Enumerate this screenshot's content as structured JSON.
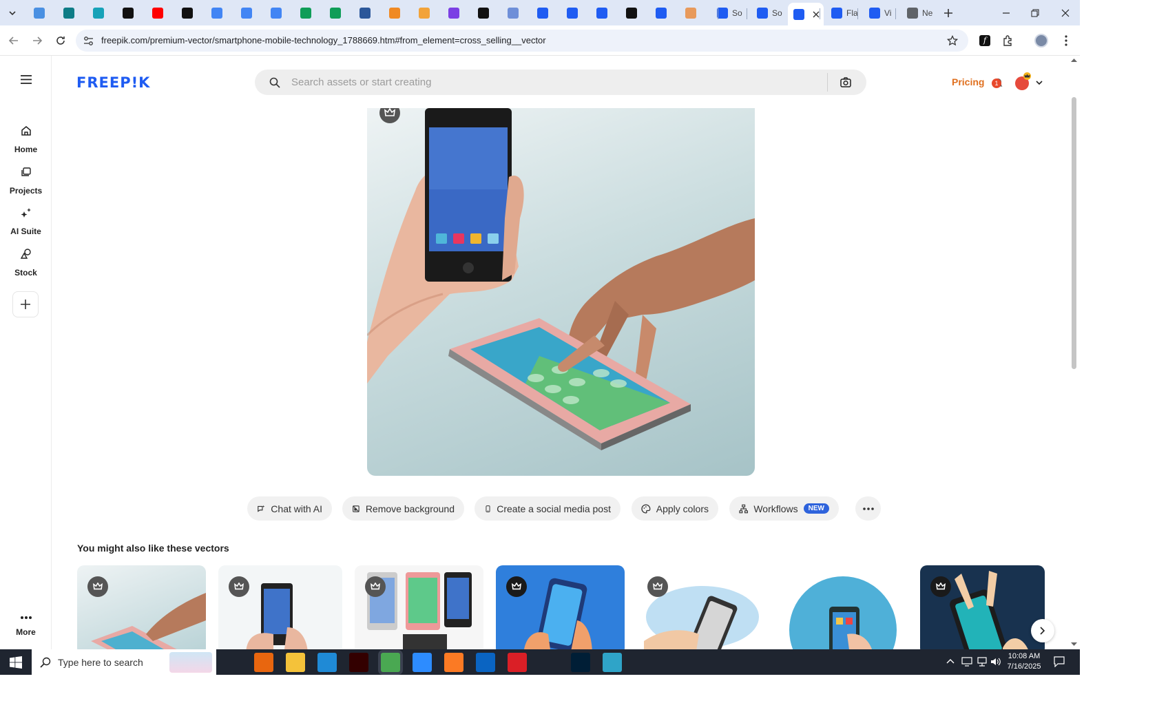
{
  "browser": {
    "tabs": [
      {
        "title": "",
        "icon": "circle-blue-icon"
      },
      {
        "title": "",
        "icon": "shield-teal-icon"
      },
      {
        "title": "",
        "icon": "hexagon-teal-icon"
      },
      {
        "title": "",
        "icon": "openai-icon"
      },
      {
        "title": "",
        "icon": "youtube-icon"
      },
      {
        "title": "",
        "icon": "bolt-icon"
      },
      {
        "title": "",
        "icon": "docs-icon"
      },
      {
        "title": "",
        "icon": "docs-icon"
      },
      {
        "title": "",
        "icon": "docs-icon"
      },
      {
        "title": "",
        "icon": "sheets-icon"
      },
      {
        "title": "",
        "icon": "sheets-icon"
      },
      {
        "title": "",
        "icon": "word-icon"
      },
      {
        "title": "",
        "icon": "orange-box-icon"
      },
      {
        "title": "",
        "icon": "chevron-logo-icon"
      },
      {
        "title": "",
        "icon": "code-braces-icon"
      },
      {
        "title": "",
        "icon": "a-logo-icon"
      },
      {
        "title": "",
        "icon": "grid-icon"
      },
      {
        "title": "",
        "icon": "freepik-icon"
      },
      {
        "title": "",
        "icon": "freepik-icon"
      },
      {
        "title": "",
        "icon": "freepik-icon"
      },
      {
        "title": "",
        "icon": "m-logo-icon"
      },
      {
        "title": "",
        "icon": "freepik-icon"
      },
      {
        "title": "",
        "icon": "hand-icon"
      },
      {
        "title": "So",
        "icon": "freepik-icon"
      },
      {
        "title": "So",
        "icon": "freepik-icon"
      },
      {
        "title": "",
        "icon": "freepik-icon"
      },
      {
        "title": "Fla",
        "icon": "freepik-icon"
      },
      {
        "title": "Vi",
        "icon": "freepik-icon"
      },
      {
        "title": "Ne",
        "icon": "chrome-icon"
      }
    ],
    "url": "freepik.com/premium-vector/smartphone-mobile-technology_1788669.htm#from_element=cross_selling__vector"
  },
  "site": {
    "logo": "FREEP!K",
    "search_placeholder": "Search assets or start creating",
    "pricing_label": "Pricing",
    "notification_count": "1",
    "colors": {
      "brand": "#1f5cf2",
      "pricing": "#e0701f",
      "new_badge": "#2e63dc"
    }
  },
  "sidebar": {
    "items": [
      {
        "label": "Home",
        "icon": "home-icon"
      },
      {
        "label": "Projects",
        "icon": "projects-icon"
      },
      {
        "label": "AI Suite",
        "icon": "sparkles-icon"
      },
      {
        "label": "Stock",
        "icon": "shapes-icon"
      }
    ],
    "more_label": "More"
  },
  "actions": {
    "chat": "Chat with AI",
    "remove_bg": "Remove background",
    "social": "Create a social media post",
    "colors": "Apply colors",
    "workflows": "Workflows",
    "new_badge": "NEW"
  },
  "related": {
    "title": "You might also like these vectors"
  },
  "taskbar": {
    "search_placeholder": "Type here to search",
    "time": "10:08 AM",
    "date": "7/16/2025",
    "apps": [
      "task-view-icon",
      "firefox-icon",
      "file-explorer-icon",
      "vscode-icon",
      "illustrator-icon",
      "chrome-icon",
      "zoom-icon",
      "xampp-icon",
      "outlook-icon",
      "creative-cloud-icon",
      "pen-tool-icon",
      "photoshop-icon",
      "app-icon"
    ]
  }
}
